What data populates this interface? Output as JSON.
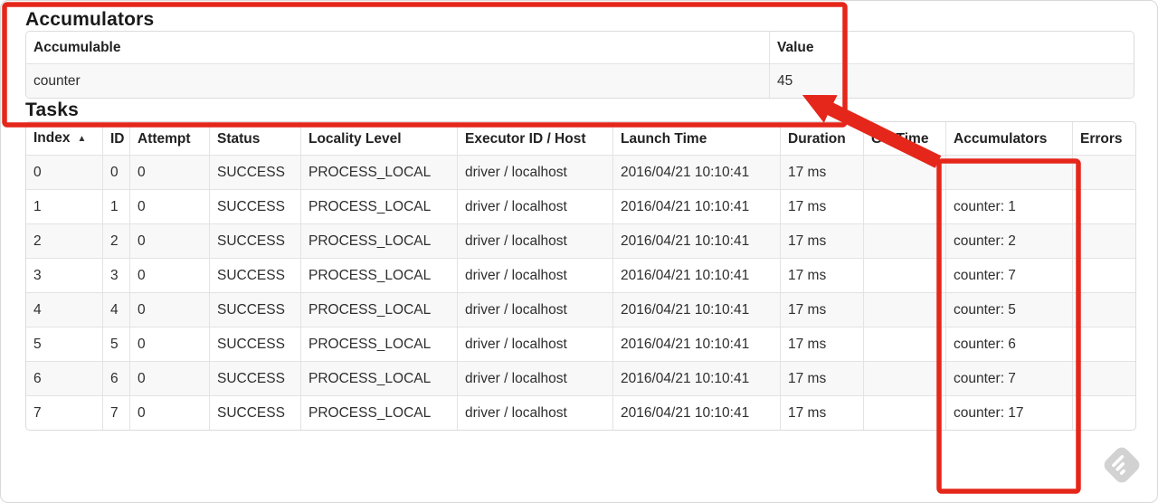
{
  "accumulators_section": {
    "title": "Accumulators",
    "table": {
      "headers": [
        "Accumulable",
        "Value"
      ],
      "rows": [
        [
          "counter",
          "45"
        ]
      ]
    }
  },
  "tasks_section": {
    "title": "Tasks",
    "sort_ascending_icon": "▲",
    "table": {
      "headers": [
        "Index",
        "ID",
        "Attempt",
        "Status",
        "Locality Level",
        "Executor ID / Host",
        "Launch Time",
        "Duration",
        "GC Time",
        "Accumulators",
        "Errors"
      ],
      "rows": [
        [
          "0",
          "0",
          "0",
          "SUCCESS",
          "PROCESS_LOCAL",
          "driver / localhost",
          "2016/04/21 10:10:41",
          "17 ms",
          "",
          "",
          ""
        ],
        [
          "1",
          "1",
          "0",
          "SUCCESS",
          "PROCESS_LOCAL",
          "driver / localhost",
          "2016/04/21 10:10:41",
          "17 ms",
          "",
          "counter: 1",
          ""
        ],
        [
          "2",
          "2",
          "0",
          "SUCCESS",
          "PROCESS_LOCAL",
          "driver / localhost",
          "2016/04/21 10:10:41",
          "17 ms",
          "",
          "counter: 2",
          ""
        ],
        [
          "3",
          "3",
          "0",
          "SUCCESS",
          "PROCESS_LOCAL",
          "driver / localhost",
          "2016/04/21 10:10:41",
          "17 ms",
          "",
          "counter: 7",
          ""
        ],
        [
          "4",
          "4",
          "0",
          "SUCCESS",
          "PROCESS_LOCAL",
          "driver / localhost",
          "2016/04/21 10:10:41",
          "17 ms",
          "",
          "counter: 5",
          ""
        ],
        [
          "5",
          "5",
          "0",
          "SUCCESS",
          "PROCESS_LOCAL",
          "driver / localhost",
          "2016/04/21 10:10:41",
          "17 ms",
          "",
          "counter: 6",
          ""
        ],
        [
          "6",
          "6",
          "0",
          "SUCCESS",
          "PROCESS_LOCAL",
          "driver / localhost",
          "2016/04/21 10:10:41",
          "17 ms",
          "",
          "counter: 7",
          ""
        ],
        [
          "7",
          "7",
          "0",
          "SUCCESS",
          "PROCESS_LOCAL",
          "driver / localhost",
          "2016/04/21 10:10:41",
          "17 ms",
          "",
          "counter: 17",
          ""
        ]
      ]
    }
  },
  "annotations": {
    "color": "#e5261a"
  },
  "watermark": {
    "color": "#d2d2d2",
    "stripe_color": "#ffffff"
  }
}
